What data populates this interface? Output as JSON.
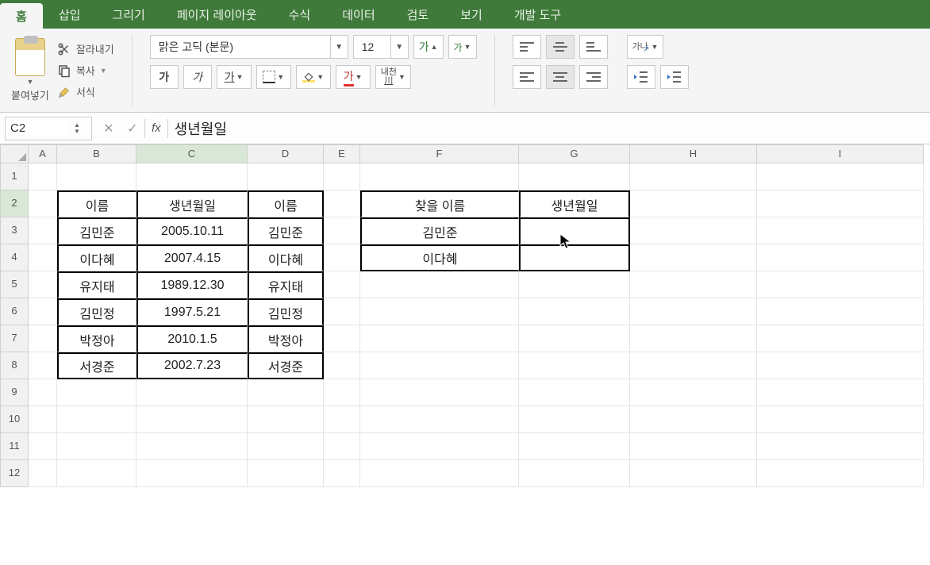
{
  "tabs": {
    "home": "홈",
    "insert": "삽입",
    "draw": "그리기",
    "page_layout": "페이지 레이아웃",
    "formulas": "수식",
    "data": "데이터",
    "review": "검토",
    "view": "보기",
    "developer": "개발 도구"
  },
  "ribbon": {
    "paste": "붙여넣기",
    "cut": "잘라내기",
    "copy": "복사",
    "format_painter": "서식",
    "font_name": "맑은 고딕 (본문)",
    "font_size": "12",
    "grow_font": "가",
    "shrink_font": "가",
    "bold": "가",
    "italic": "가",
    "underline": "가",
    "font_color": "가",
    "naecheon": "내천\n川"
  },
  "formula_bar": {
    "name_box": "C2",
    "fx_label": "fx",
    "formula": "생년월일"
  },
  "columns": [
    "A",
    "B",
    "C",
    "D",
    "E",
    "F",
    "G",
    "H",
    "I"
  ],
  "rows": [
    "1",
    "2",
    "3",
    "4",
    "5",
    "6",
    "7",
    "8",
    "9",
    "10",
    "11",
    "12"
  ],
  "table1": {
    "headers": {
      "B": "이름",
      "C": "생년월일",
      "D": "이름"
    },
    "rows": [
      {
        "B": "김민준",
        "C": "2005.10.11",
        "D": "김민준"
      },
      {
        "B": "이다혜",
        "C": "2007.4.15",
        "D": "이다혜"
      },
      {
        "B": "유지태",
        "C": "1989.12.30",
        "D": "유지태"
      },
      {
        "B": "김민정",
        "C": "1997.5.21",
        "D": "김민정"
      },
      {
        "B": "박정아",
        "C": "2010.1.5",
        "D": "박정아"
      },
      {
        "B": "서경준",
        "C": "2002.7.23",
        "D": "서경준"
      }
    ]
  },
  "table2": {
    "headers": {
      "F": "찾을 이름",
      "G": "생년월일"
    },
    "rows": [
      {
        "F": "김민준",
        "G": ""
      },
      {
        "F": "이다혜",
        "G": ""
      }
    ]
  }
}
